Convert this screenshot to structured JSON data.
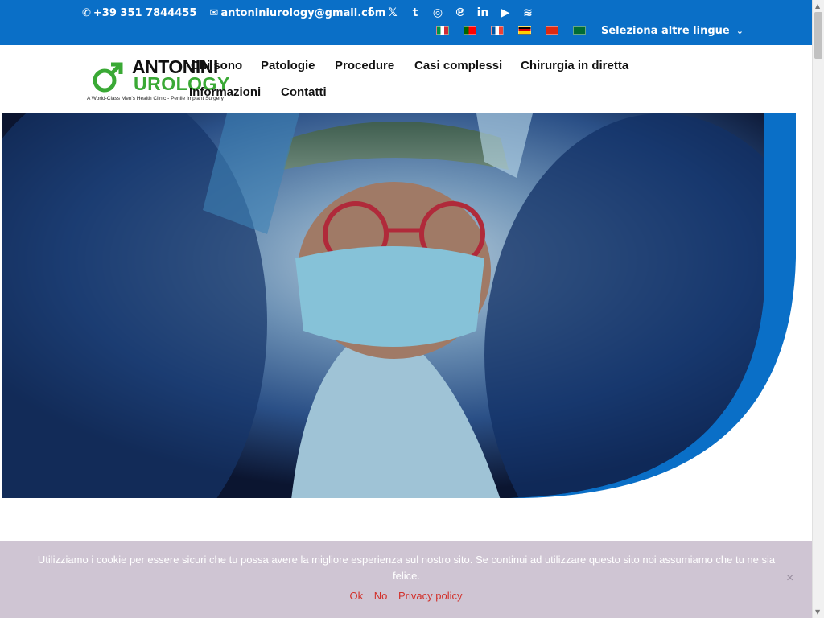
{
  "topbar": {
    "phone": "+39 351 7844455",
    "email": "antoniniurology@gmail.com",
    "social_icons": [
      "facebook-icon",
      "x-twitter-icon",
      "tumblr-icon",
      "instagram-icon",
      "pinterest-icon",
      "linkedin-icon",
      "youtube-icon",
      "rss-icon"
    ],
    "social_glyphs": [
      "f",
      "𝕏",
      "t",
      "◎",
      "℗",
      "in",
      "▶",
      "≋"
    ],
    "flags": [
      "italian-flag-icon",
      "portuguese-flag-icon",
      "french-flag-icon",
      "german-flag-icon",
      "chinese-flag-icon",
      "saudi-flag-icon"
    ],
    "language_select": "Seleziona altre lingue"
  },
  "logo": {
    "line1": "ANTONINI",
    "line2": "UROLOGY",
    "tagline": "A World-Class Men's Health Clinic - Penile Implant Surgery"
  },
  "nav": {
    "items": [
      "Chi sono",
      "Patologie",
      "Procedure",
      "Casi complessi",
      "Chirurgia in diretta",
      "Informazioni",
      "Contatti"
    ]
  },
  "cookie": {
    "message": "Utilizziamo i cookie per essere sicuri che tu possa avere la migliore esperienza sul nostro sito. Se continui ad utilizzare questo sito noi assumiamo che tu ne sia felice.",
    "ok": "Ok",
    "no": "No",
    "privacy": "Privacy policy",
    "close": "×"
  },
  "colors": {
    "topbar": "#0a6fc7",
    "accent_green": "#3aa935",
    "cookie_bg": "#cfc5d3",
    "cookie_link": "#d2312b"
  }
}
